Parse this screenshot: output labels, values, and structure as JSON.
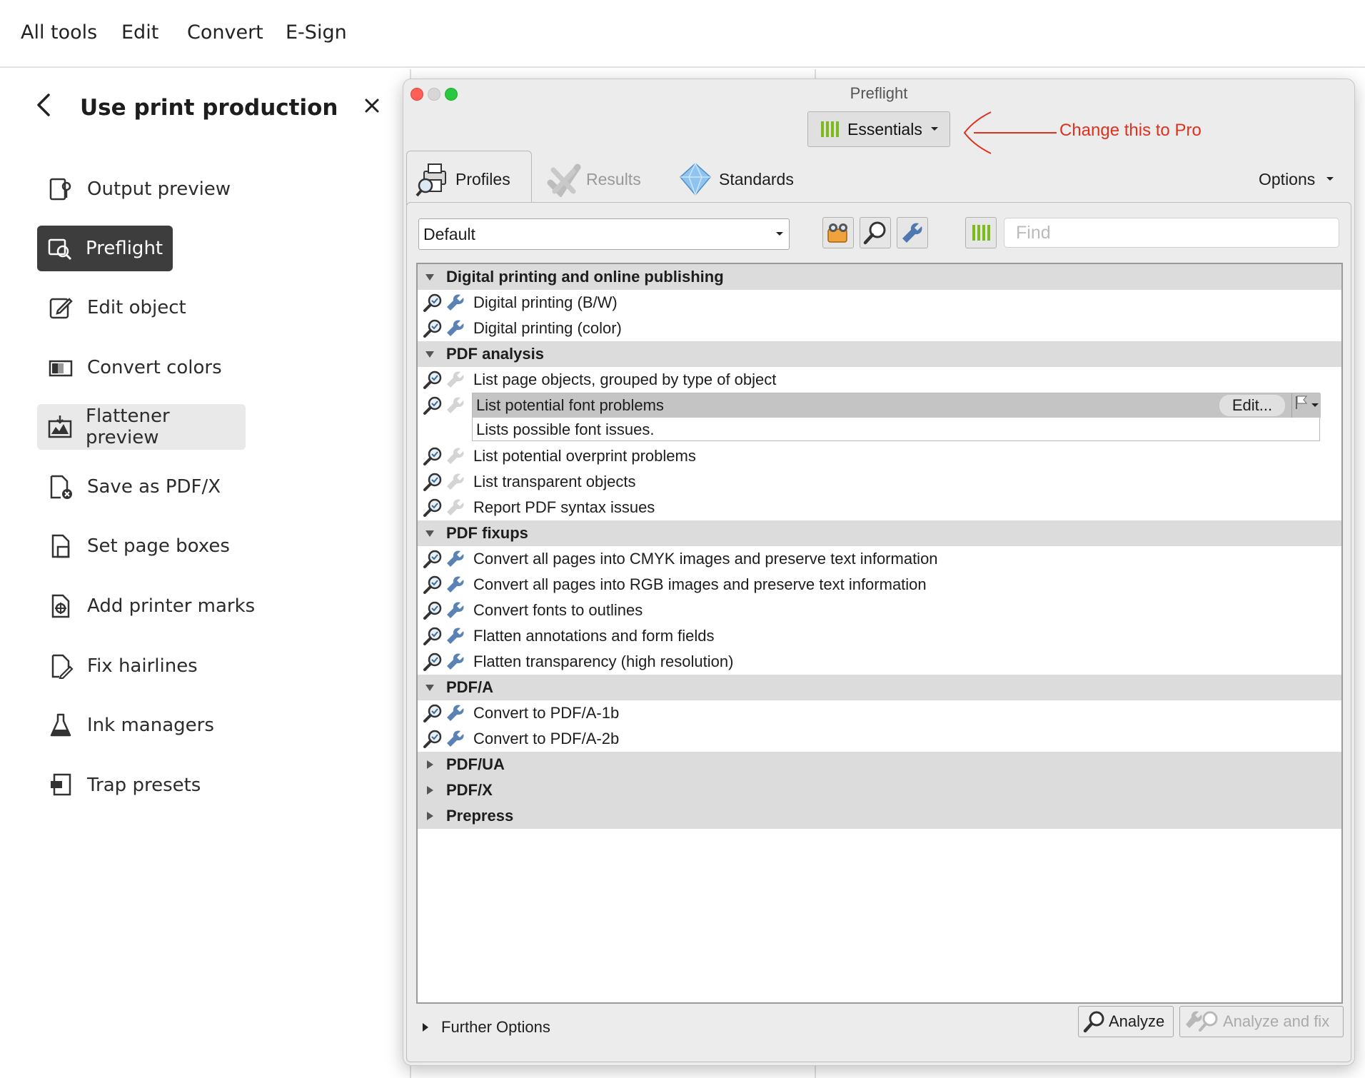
{
  "topbar": {
    "menu": [
      "All tools",
      "Edit",
      "Convert",
      "E-Sign"
    ]
  },
  "left_panel": {
    "title": "Use print production",
    "items": [
      {
        "label": "Output preview",
        "icon": "output-preview-icon"
      },
      {
        "label": "Preflight",
        "icon": "preflight-icon",
        "selected": true
      },
      {
        "label": "Edit object",
        "icon": "edit-object-icon"
      },
      {
        "label": "Convert colors",
        "icon": "convert-colors-icon"
      },
      {
        "label": "Flattener preview",
        "icon": "flattener-preview-icon",
        "hovered": true
      },
      {
        "label": "Save as PDF/X",
        "icon": "save-pdfx-icon"
      },
      {
        "label": "Set page boxes",
        "icon": "page-boxes-icon"
      },
      {
        "label": "Add printer marks",
        "icon": "printer-marks-icon"
      },
      {
        "label": "Fix hairlines",
        "icon": "fix-hairlines-icon"
      },
      {
        "label": "Ink managers",
        "icon": "ink-manager-icon"
      },
      {
        "label": "Trap presets",
        "icon": "trap-presets-icon"
      }
    ]
  },
  "preflight": {
    "window_title": "Preflight",
    "mode_button": "Essentials",
    "annotation": "Change this to Pro",
    "tabs": {
      "profiles": "Profiles",
      "results": "Results",
      "standards": "Standards",
      "options": "Options"
    },
    "library": "Default",
    "find_placeholder": "Find",
    "groups": {
      "g1": "Digital printing and online publishing",
      "g2": "PDF analysis",
      "g3": "PDF fixups",
      "g4": "PDF/A",
      "g5": "PDF/UA",
      "g6": "PDF/X",
      "g7": "Prepress"
    },
    "profiles": {
      "p1": "Digital printing (B/W)",
      "p2": "Digital printing (color)",
      "p3": "List page objects, grouped by type of object",
      "p4": "List potential font problems",
      "p4_desc": "Lists possible font issues.",
      "p5": "List potential overprint problems",
      "p6": "List transparent objects",
      "p7": "Report PDF syntax issues",
      "p8": "Convert all pages into CMYK images and preserve text information",
      "p9": "Convert all pages into RGB images and preserve text information",
      "p10": "Convert fonts to outlines",
      "p11": "Flatten annotations and form fields",
      "p12": "Flatten transparency (high resolution)",
      "p13": "Convert to PDF/A-1b",
      "p14": "Convert to PDF/A-2b"
    },
    "edit_button": "Edit...",
    "further_options": "Further Options",
    "analyze": "Analyze",
    "analyze_fix": "Analyze and fix",
    "colors": {
      "accent_green": "#7dbb1c",
      "annotation_red": "#e0301e",
      "selected_nav": "#3d3d3d"
    }
  }
}
